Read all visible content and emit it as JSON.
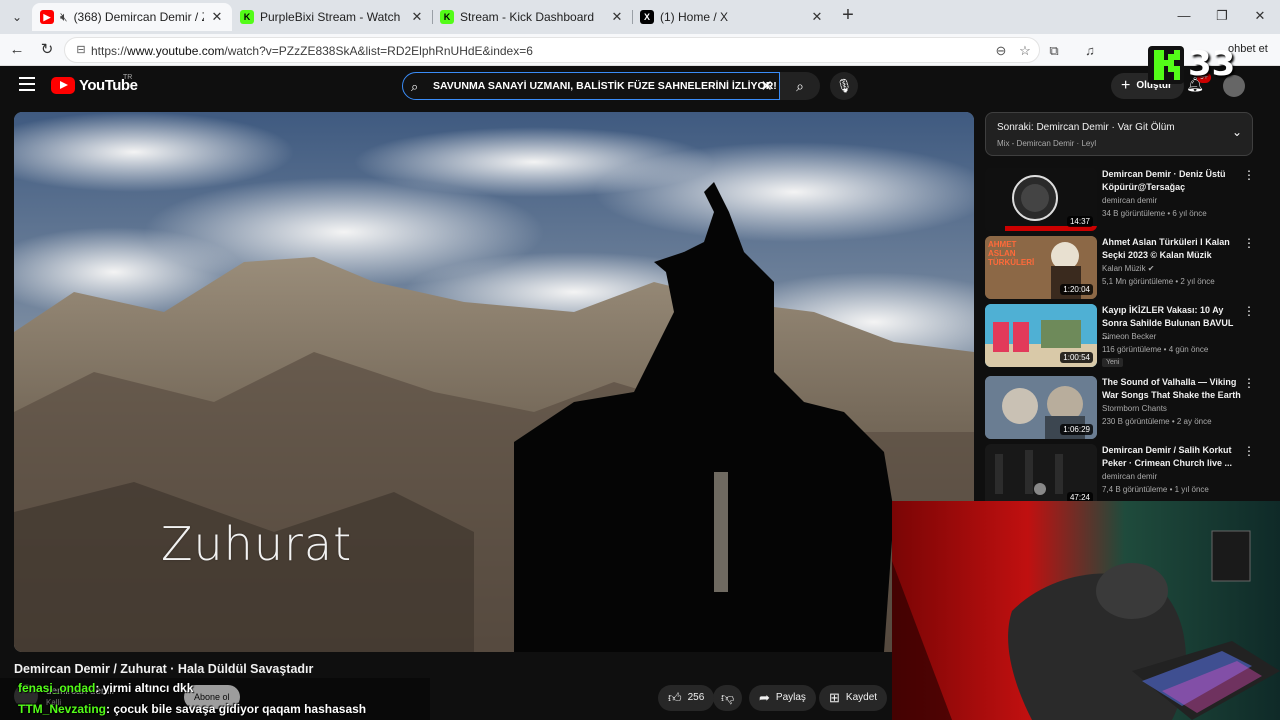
{
  "browser": {
    "tabs": [
      {
        "title": "(368) Demircan Demir / Zuhu",
        "favicon": "youtube-icon",
        "muted": true,
        "active": true
      },
      {
        "title": "PurpleBixi Stream - Watch Live on",
        "favicon": "kick-icon",
        "active": false
      },
      {
        "title": "Stream - Kick Dashboard",
        "favicon": "kick-icon",
        "active": false
      },
      {
        "title": "(1) Home / X",
        "favicon": "x-icon",
        "active": false
      }
    ],
    "url_prefix": "https://",
    "url_host": "www.youtube.com",
    "url_path": "/watch?v=PZzZE838SkA&list=RD2ElphRnUHdE&index=6",
    "sohbet_label": "ohbet et"
  },
  "youtube": {
    "logo_text": "YouTube",
    "country_code": "TR",
    "search_query": "SAVUNMA SANAYİ UZMANI, BALİSTİK FÜZE SAHNELERİNİ İZLİYOR!",
    "create_label": "Oluştur",
    "notif_badge": "9+",
    "video_overlay_text": "Zuhurat",
    "video_title": "Demircan Demir / Zuhurat · Hala Düldül Savaştadır",
    "channel_name": "demircan demir",
    "channel_subs": "Kalli",
    "subscribe_label": "Abone ol",
    "like_count": "256",
    "share_label": "Paylaş",
    "save_label": "Kaydet",
    "up_next": {
      "title": "Sonraki: Demircan Demir · Var Git Ölüm",
      "subtitle": "Mix - Demircan Demir · Leyl"
    },
    "recommendations": [
      {
        "title": "Demircan Demir · Deniz Üstü Köpürür@Tersağaç",
        "channel": "demircan demir",
        "meta": "34 B görüntüleme • 6 yıl önce",
        "duration": "14:37",
        "new": ""
      },
      {
        "title": "Ahmet Aslan Türküleri I Kalan Seçki 2023 © Kalan Müzik",
        "channel": "Kalan Müzik ✔",
        "meta": "5,1 Mn görüntüleme • 2 yıl önce",
        "duration": "1:20:04",
        "new": "",
        "thumb_text": "AHMET ASLAN TÜRKÜLERİ"
      },
      {
        "title": "Kayıp İKİZLER Vakası:   10 Ay Sonra Sahilde Bulunan BAVUL ...",
        "channel": "Simeon Becker",
        "meta": "116 görüntüleme • 4 gün önce",
        "duration": "1:00:54",
        "new": "Yeni"
      },
      {
        "title": "The Sound of Valhalla — Viking War Songs That Shake the Earth",
        "channel": "Stormborn Chants",
        "meta": "230 B görüntüleme • 2 ay önce",
        "duration": "1:06:29",
        "new": ""
      },
      {
        "title": "Demircan Demir / Salih Korkut Peker · Crimean Church live ...",
        "channel": "demircan demir",
        "meta": "7,4 B görüntüleme • 1 yıl önce",
        "duration": "47:24",
        "new": ""
      }
    ]
  },
  "overlay": {
    "kick_badge": "33",
    "chat": [
      {
        "user": "fenasi_ondad",
        "message": ": yirmi altıncı dkk"
      },
      {
        "user": "TTM_Nevzating",
        "message": ": çocuk bile savaşa gidiyor qaqam hashasash"
      }
    ]
  },
  "colors": {
    "youtube_red": "#ff0000",
    "kick_green": "#53fc18",
    "accent_blue": "#3a8cf7"
  }
}
